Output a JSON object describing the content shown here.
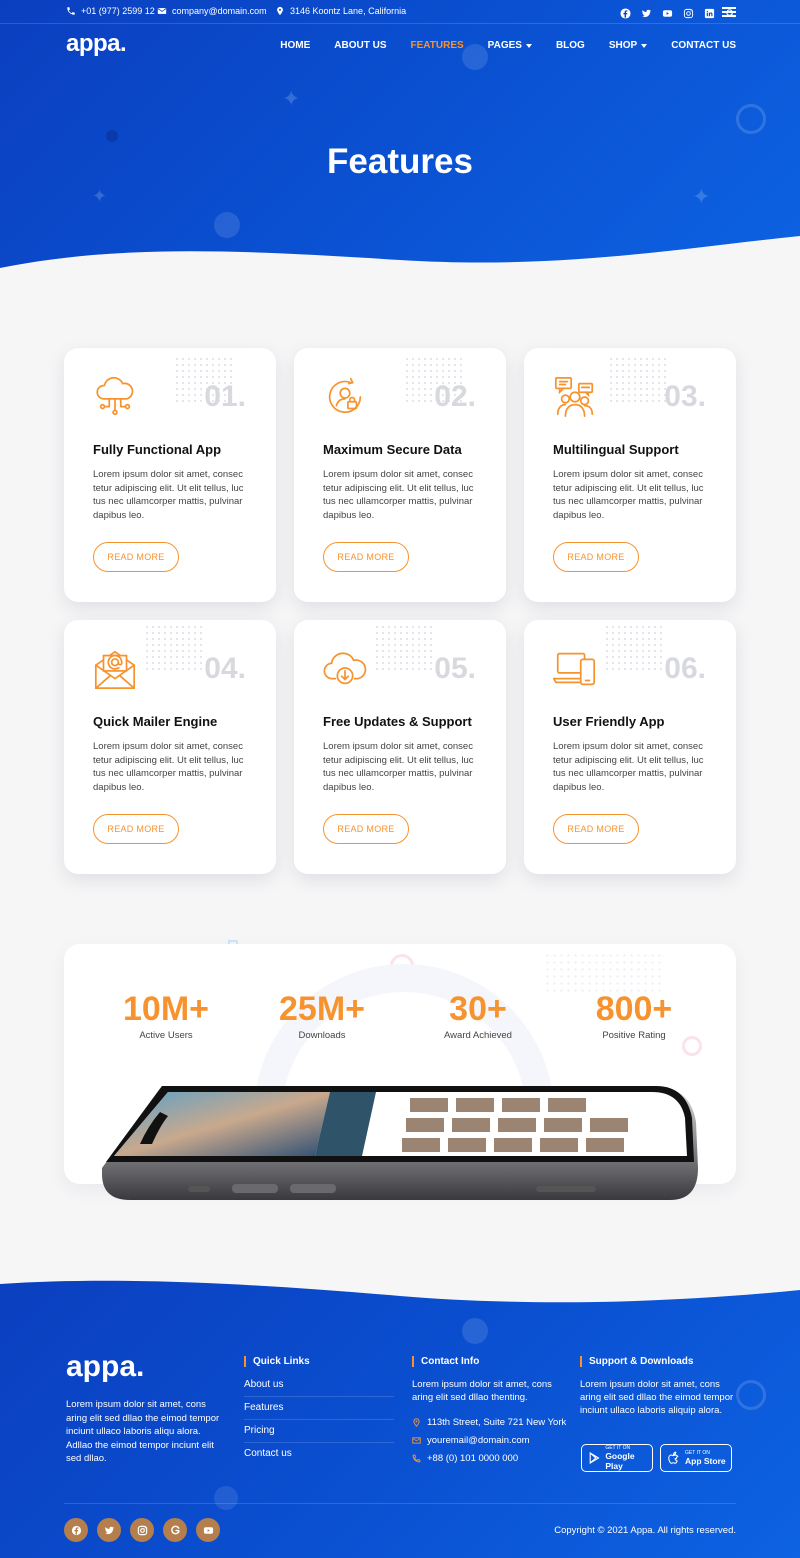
{
  "topbar": {
    "phone": "+01 (977) 2599 12",
    "email": "company@domain.com",
    "address": "3146 Koontz Lane, California",
    "social_icons": [
      "facebook-icon",
      "twitter-icon",
      "youtube-icon",
      "instagram-icon",
      "linkedin-icon",
      "search-icon",
      "hamburger-icon"
    ]
  },
  "nav": {
    "logo": "appa.",
    "items": [
      {
        "label": "HOME"
      },
      {
        "label": "ABOUT US"
      },
      {
        "label": "FEATURES"
      },
      {
        "label": "PAGES"
      },
      {
        "label": "BLOG"
      },
      {
        "label": "SHOP"
      },
      {
        "label": "CONTACT US"
      }
    ],
    "active": "FEATURES"
  },
  "hero": {
    "title": "Features"
  },
  "features": [
    {
      "num": "01.",
      "title": "Fully Functional App",
      "desc": "Lorem ipsum dolor sit amet, consec tetur adipiscing elit. Ut elit tellus, luc tus nec ullamcorper mattis, pulvinar dapibus leo.",
      "button": "READ MORE",
      "icon": "cloud-network-icon"
    },
    {
      "num": "02.",
      "title": "Maximum Secure Data",
      "desc": "Lorem ipsum dolor sit amet, consec tetur adipiscing elit. Ut elit tellus, luc tus nec ullamcorper mattis, pulvinar dapibus leo.",
      "button": "READ MORE",
      "icon": "secure-user-icon"
    },
    {
      "num": "03.",
      "title": "Multilingual Support",
      "desc": "Lorem ipsum dolor sit amet, consec tetur adipiscing elit. Ut elit tellus, luc tus nec ullamcorper mattis, pulvinar dapibus leo.",
      "button": "READ MORE",
      "icon": "chat-people-icon"
    },
    {
      "num": "04.",
      "title": "Quick Mailer Engine",
      "desc": "Lorem ipsum dolor sit amet, consec tetur adipiscing elit. Ut elit tellus, luc tus nec ullamcorper mattis, pulvinar dapibus leo.",
      "button": "READ MORE",
      "icon": "mail-envelope-icon"
    },
    {
      "num": "05.",
      "title": "Free Updates & Support",
      "desc": "Lorem ipsum dolor sit amet, consec tetur adipiscing elit. Ut elit tellus, luc tus nec ullamcorper mattis, pulvinar dapibus leo.",
      "button": "READ MORE",
      "icon": "cloud-download-icon"
    },
    {
      "num": "06.",
      "title": "User Friendly App",
      "desc": "Lorem ipsum dolor sit amet, consec tetur adipiscing elit. Ut elit tellus, luc tus nec ullamcorper mattis, pulvinar dapibus leo.",
      "button": "READ MORE",
      "icon": "devices-icon"
    }
  ],
  "stats": [
    {
      "value": "10M+",
      "label": "Active Users"
    },
    {
      "value": "25M+",
      "label": "Downloads"
    },
    {
      "value": "30+",
      "label": "Award Achieved"
    },
    {
      "value": "800+",
      "label": "Positive Rating"
    }
  ],
  "footer": {
    "logo": "appa.",
    "about": "Lorem ipsum dolor sit amet, cons aring elit sed dllao the eimod tempor inciunt ullaco laboris aliqu alora. Adllao the eimod tempor inciunt elit sed dllao.",
    "quick_links_title": "Quick Links",
    "quick_links": [
      "About us",
      "Features",
      "Pricing",
      "Contact us"
    ],
    "contact_title": "Contact Info",
    "contact_text": "Lorem ipsum dolor sit amet, cons aring elit sed dllao thenting.",
    "contact_address": "113th Street, Suite 721 New York",
    "contact_email": "youremail@domain.com",
    "contact_phone": "+88 (0) 101 0000 000",
    "support_title": "Support & Downloads",
    "support_text": "Lorem ipsum dolor sit amet, cons aring elit sed dllao the eimod tempor inciunt ullaco laboris aliquip alora.",
    "google_play_small": "GET IT ON",
    "google_play": "Google Play",
    "app_store_small": "GET IT ON",
    "app_store": "App Store",
    "social_icons": [
      "facebook-icon",
      "twitter-icon",
      "instagram-icon",
      "google-icon",
      "youtube-icon"
    ],
    "copyright": "Copyright © 2021 Appa. All rights reserved."
  },
  "colors": {
    "primary_blue": "#0a4fd0",
    "accent_orange": "#f7932f",
    "social_brown": "#b47f4c"
  }
}
